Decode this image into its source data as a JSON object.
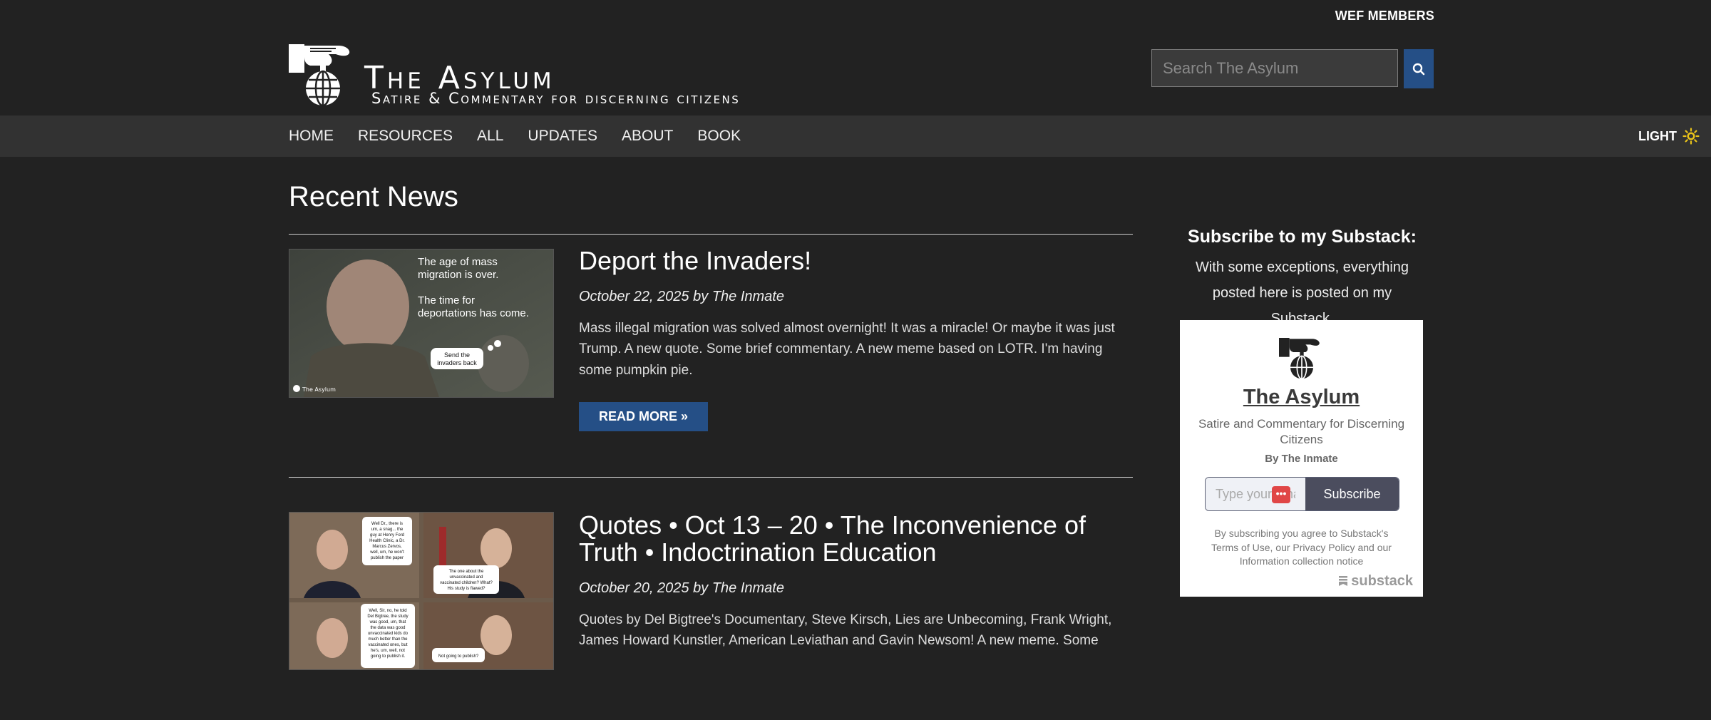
{
  "topbar": {
    "members_link": "WEF MEMBERS"
  },
  "site": {
    "title": "The Asylum",
    "tagline": "Satire & Commentary for discerning citizens"
  },
  "search": {
    "placeholder": "Search The Asylum"
  },
  "nav": {
    "items": [
      "HOME",
      "RESOURCES",
      "ALL",
      "UPDATES",
      "ABOUT",
      "BOOK"
    ],
    "theme_label": "LIGHT"
  },
  "main": {
    "section_title": "Recent News",
    "posts": [
      {
        "title": "Deport the Invaders!",
        "date": "October 22, 2025",
        "by": "by",
        "author": "The Inmate",
        "excerpt": "Mass illegal migration was solved almost overnight! It was a miracle! Or maybe it was just Trump. A new quote. Some brief commentary. A new meme based on LOTR. I'm having some pumpkin pie.",
        "read_more": "READ MORE »",
        "thumb_text": {
          "line1": "The age of mass",
          "line2": "migration is over.",
          "line3": "The time for",
          "line4": "deportations has come.",
          "bubble1": "Send the",
          "bubble2": "invaders back",
          "watermark": "The Asylum"
        }
      },
      {
        "title": "Quotes • Oct 13 – 20 • The Inconvenience of Truth • Indoctrination Education",
        "date": "October 20, 2025",
        "by": "by",
        "author": "The Inmate",
        "excerpt": "Quotes by Del Bigtree's Documentary, Steve Kirsch, Lies are Unbecoming, Frank Wright, James Howard Kunstler, American Leviathan and Gavin Newsom! A new meme. Some",
        "thumb_text": {
          "b1l1": "Well Dr., there is",
          "b1l2": "um, a snag... the",
          "b1l3": "guy at Henry Ford",
          "b1l4": "Health Clinic, a Dr.",
          "b1l5": "Marcus Zervos,",
          "b1l6": "well, um, he won't",
          "b1l7": "publish the paper",
          "b2l1": "The one about the",
          "b2l2": "unvaccinated and",
          "b2l3": "vaccinated children? What?",
          "b2l4": "His study is flawed?",
          "b3l1": "Well, Sir, no, he told",
          "b3l2": "Del Bigtree, the study",
          "b3l3": "was good, um, that",
          "b3l4": "the data was good",
          "b3l5": "unvaccinated kids do",
          "b3l6": "much better than the",
          "b3l7": "vaccinated ones, but",
          "b3l8": "he's, um, well, not",
          "b3l9": "going to publish it.",
          "b4l1": "Not going to publish?"
        }
      }
    ]
  },
  "sidebar": {
    "title": "Subscribe to my Substack:",
    "text": "With some exceptions, everything posted here is posted on my Substack.",
    "embed": {
      "pub_name": "The Asylum",
      "description": "Satire and Commentary for Discerning Citizens",
      "author": "By The Inmate",
      "email_placeholder": "Type your email...",
      "dots": "•••",
      "subscribe_label": "Subscribe",
      "legal_prefix": "By subscribing you agree to ",
      "terms": "Substack's Terms of Use",
      "sep1": ", ",
      "privacy": "our Privacy Policy",
      "sep2": " and ",
      "info": "our Information collection notice",
      "brand": "substack"
    }
  },
  "colors": {
    "background": "#222222",
    "nav_bar": "#323232",
    "accent": "#254f86",
    "sun_icon": "#e8c21a"
  }
}
